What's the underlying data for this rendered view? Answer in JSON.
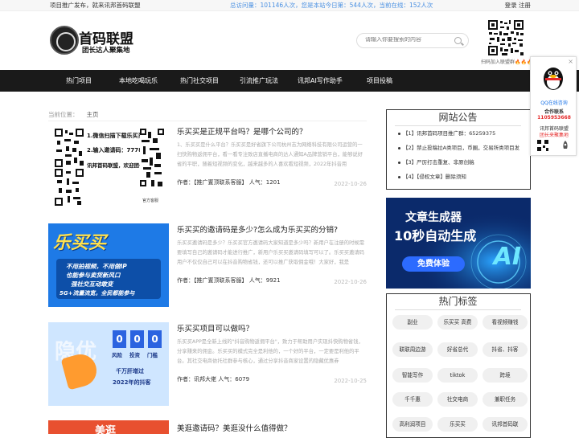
{
  "topbar": {
    "left": "项目推广发布，就来讯邦首码联盟",
    "mid": "总访问量：101146人次，您是本站今日第：544人次，当前在线：152人次",
    "right": "登录 注册"
  },
  "logo": {
    "title": "首码联盟",
    "subtitle": "团长达人聚集地"
  },
  "search": {
    "placeholder": "请输入你要搜索的内容"
  },
  "qr_caption": "扫码加入联盟群🔥🔥🔥",
  "nav": [
    "热门项目",
    "本地吃喝玩乐",
    "热门社交项目",
    "引流推广玩法",
    "讯邦AI写作助手",
    "项目投稿"
  ],
  "breadcrumb": {
    "label": "当前位置：",
    "current": "主页"
  },
  "posts": [
    {
      "title": "乐买买是正规平台吗？是哪个公司的？",
      "excerpt": "1、乐买买是什么平台？乐买买是好省旗下公司杭州志为网络科技有限公司运营的一扫快购物返佣平台，看一看专注致店直播电商的达人通知A品牌营销平台，能够说好省的平职，随着短视频的变化，越来越多的人喜欢看短视频，2022年抖音用",
      "author": "作者：【推广置顶联系客服】",
      "views": "人气：1201",
      "date": "2022-10-26",
      "thumb_text": [
        "1.微信扫描下载乐买买APP",
        "2.输入邀请码：777818",
        "讯邦首码联盟，欢迎团长对接！",
        "官方客服"
      ]
    },
    {
      "title": "乐买买的邀请码是多少?怎么成为乐买买的分销?",
      "excerpt": "乐买买邀请码是多少？乐买买官方邀请码大家知道是多少吗？新用户在注册的时候需要填写自己的邀请码才能进行推广，新用户乐买买邀请码填写可以了。乐买买邀请码用户不仅仅自己可以在抖音购物省钱，还可以推广获取佣金哦！大家好，我是",
      "author": "作者：【推广置顶联系客服】",
      "views": "人气：9921",
      "date": "2022-10-26",
      "thumb_text": [
        "乐买买",
        "不用拍视频，不用做IP",
        "也能参与卖货新风口",
        "强社交互动敢变",
        "5G+流量流宽，全民都能参与"
      ]
    },
    {
      "title": "乐买买项目可以做吗？",
      "excerpt": "乐买买APP是全新上线的\"抖音购物返佣平台\"，致力于帮助用户实现抖快购物省钱，分享赚来的佣金。乐买买的模式完全是利他的，一个好的平台，一定要是利他的平台。其社交电商依托社群参与核心，通过分享抖音商家设置的隐藏优惠券",
      "author": "作者：讯邦大佬",
      "views": "人气：6079",
      "date": "2022-10-25",
      "thumb_text": [
        "0",
        "0",
        "0",
        "风险",
        "投资",
        "门槛",
        "千万肝增过",
        "2022年的抖客"
      ]
    },
    {
      "title": "美逛邀请码？美逛没什么值得做？",
      "excerpt": "",
      "author": "",
      "views": "",
      "date": "",
      "thumb_text": [
        "美逛"
      ]
    }
  ],
  "notice": {
    "title": "网站公告",
    "items": [
      "【1】讯邦首码项目推广群：65259375",
      "【2】禁止投稿拉A类项目，币圈，交易所类项目发",
      "【3】严厉打击重复、非原创稿",
      "【4】【侵权文章】删除须知"
    ]
  },
  "ad": {
    "line1": "文章生成器",
    "line2": "10秒自动生成",
    "button": "免费体验",
    "ai": "AI"
  },
  "tags": {
    "title": "热门标签",
    "items": [
      "副业",
      "乐买买 高费",
      "看视频赚钱",
      "联联周边游",
      "好省总代",
      "抖省、抖客",
      "智能写作",
      "tiktok",
      "跨境",
      "千千惠",
      "社交电商",
      "兼职任务",
      "高利润项目",
      "乐买买",
      "讯邦首码联"
    ]
  },
  "float_qq": {
    "label": "QQ在线咨询",
    "line1": "合作联系",
    "line2": "1105953668",
    "line3": "讯邦首码联盟",
    "line4": "团长来聚集地"
  },
  "colors": {
    "nav_bg": "#1a1a1a",
    "accent": "#4a90e2",
    "ad_bg": "#0b2a6b"
  }
}
